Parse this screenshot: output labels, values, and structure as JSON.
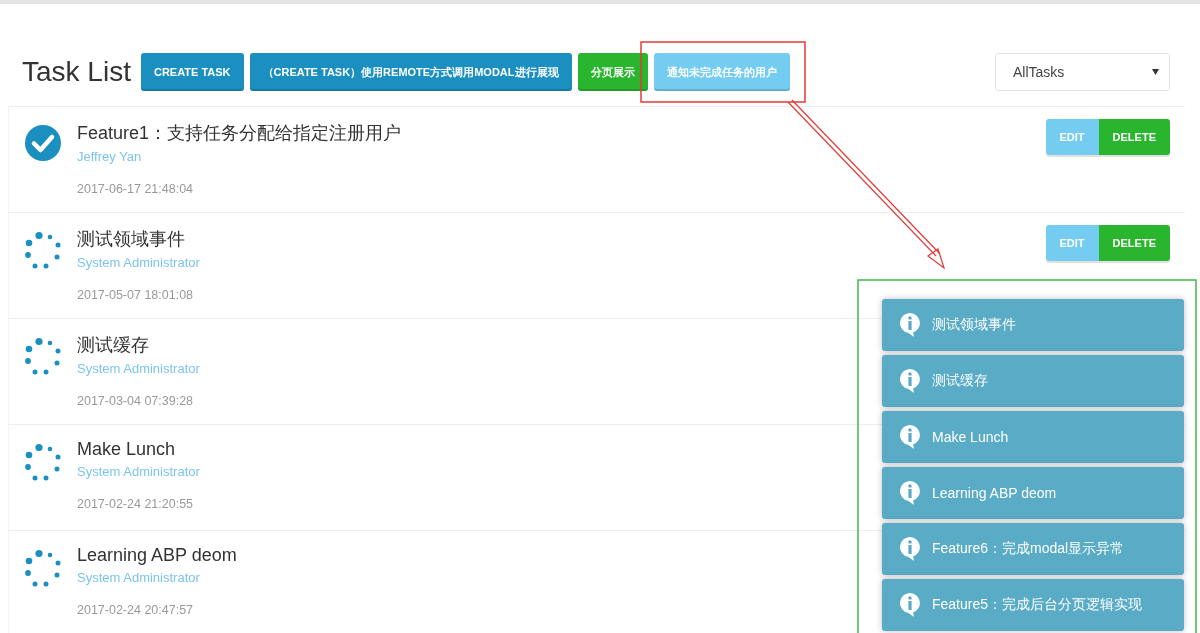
{
  "header": {
    "title": "Task List",
    "buttons": [
      {
        "label": "CREATE TASK",
        "kind": "primary"
      },
      {
        "label": "（CREATE TASK）使用REMOTE方式调用MODAL进行展现",
        "kind": "primary"
      },
      {
        "label": "分页展示",
        "kind": "success"
      },
      {
        "label": "通知未完成任务的用户",
        "kind": "info"
      }
    ],
    "filter": {
      "value": "AllTasks"
    }
  },
  "tasks": [
    {
      "title": "Feature1：支持任务分配给指定注册用户",
      "assignee": "Jeffrey Yan",
      "date": "2017-06-17 21:48:04",
      "completed": true,
      "actions": [
        "EDIT",
        "DELETE"
      ]
    },
    {
      "title": "测试领域事件",
      "assignee": "System Administrator",
      "date": "2017-05-07 18:01:08",
      "completed": false,
      "actions": [
        "EDIT",
        "DELETE"
      ]
    },
    {
      "title": "测试缓存",
      "assignee": "System Administrator",
      "date": "2017-03-04 07:39:28",
      "completed": false
    },
    {
      "title": "Make Lunch",
      "assignee": "System Administrator",
      "date": "2017-02-24 21:20:55",
      "completed": false
    },
    {
      "title": "Learning ABP deom",
      "assignee": "System Administrator",
      "date": "2017-02-24 20:47:57",
      "completed": false
    }
  ],
  "notifications": [
    {
      "message": "测试领域事件"
    },
    {
      "message": "测试缓存"
    },
    {
      "message": "Make Lunch"
    },
    {
      "message": "Learning ABP deom"
    },
    {
      "message": "Feature6：完成modal显示异常"
    },
    {
      "message": "Feature5：完成后台分页逻辑实现"
    }
  ]
}
